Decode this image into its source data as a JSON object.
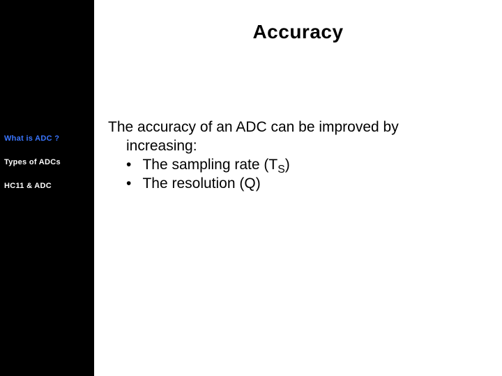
{
  "title": "Accuracy",
  "intro_line1": "The accuracy of an ADC can be improved by",
  "intro_line2": "increasing:",
  "bullets": [
    {
      "prefix": "The sampling rate (T",
      "sub": "S",
      "suffix": ")"
    },
    {
      "prefix": "The resolution (Q)",
      "sub": "",
      "suffix": ""
    }
  ],
  "nav": {
    "items": [
      {
        "label": "What is ADC ?",
        "active": true
      },
      {
        "label": "Types of ADCs",
        "active": false
      },
      {
        "label": "HC11 & ADC",
        "active": false
      }
    ]
  }
}
